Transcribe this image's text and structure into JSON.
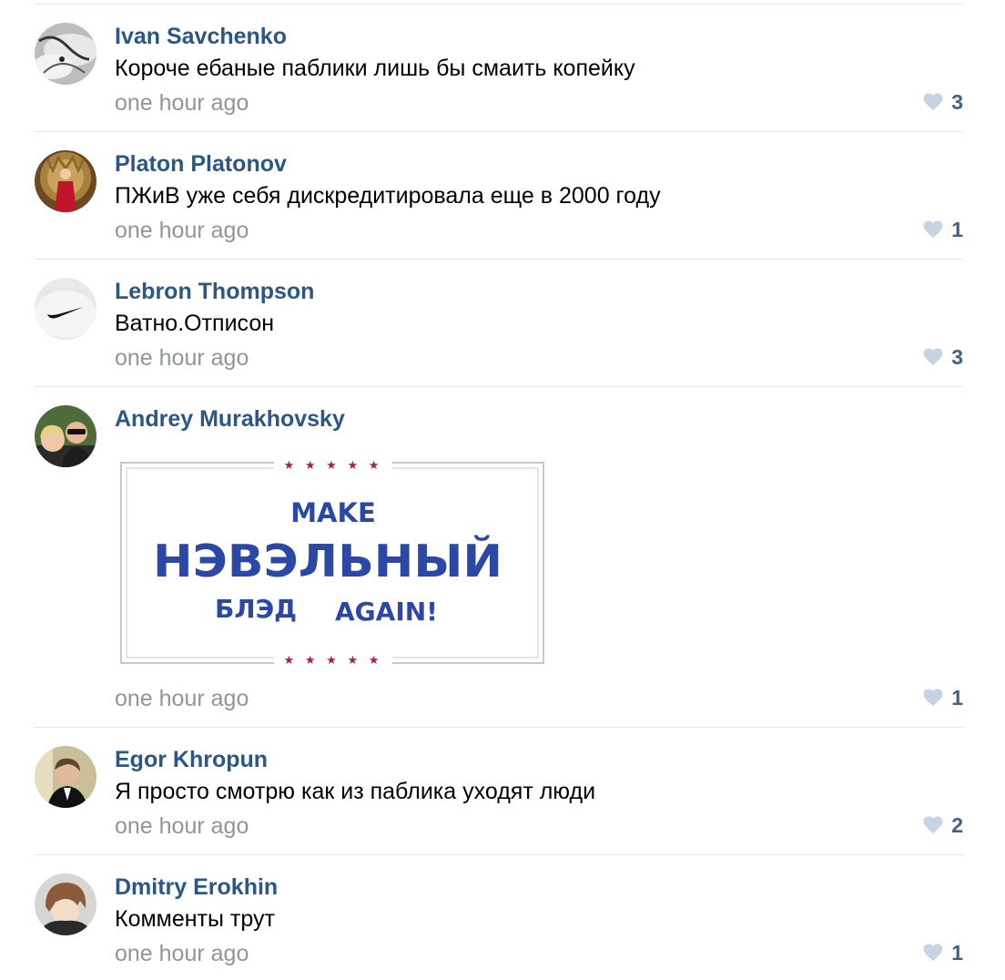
{
  "comments": [
    {
      "author": "Ivan Savchenko",
      "text": "Короче ебаные паблики лишь бы смаить копейку",
      "time": "one hour ago",
      "likes": "3",
      "avatar": "grayscale-photo-icon"
    },
    {
      "author": "Platon Platonov",
      "text": "ПЖиВ уже себя дискредитировала еще в 2000 году",
      "time": "one hour ago",
      "likes": "1",
      "avatar": "throne-photo-icon"
    },
    {
      "author": "Lebron Thompson",
      "text": "Ватно.Отписон",
      "time": "one hour ago",
      "likes": "3",
      "avatar": "swoosh-logo-icon"
    },
    {
      "author": "Andrey Murakhovsky",
      "time": "one hour ago",
      "likes": "1",
      "avatar": "couple-photo-icon",
      "attachment": {
        "line1": "MAKE",
        "line2": "НЭВЭЛЬНЫЙ",
        "line3a": "БЛЭД",
        "line3b": "AGAIN!",
        "stars": "★ ★ ★ ★ ★",
        "text_color": "#2c48a6",
        "star_color": "#b22234"
      }
    },
    {
      "author": "Egor Khropun",
      "text": "Я просто смотрю как из паблика уходят люди",
      "time": "one hour ago",
      "likes": "2",
      "avatar": "man-photo-icon"
    },
    {
      "author": "Dmitry Erokhin",
      "text": "Комменты трут",
      "time": "one hour ago",
      "likes": "1",
      "avatar": "anime-photo-icon"
    }
  ],
  "colors": {
    "author": "#2b5787",
    "time": "#8f959c",
    "heart": "#c5d3e2",
    "like_count": "#3f6186",
    "divider": "#e3e6ea"
  }
}
